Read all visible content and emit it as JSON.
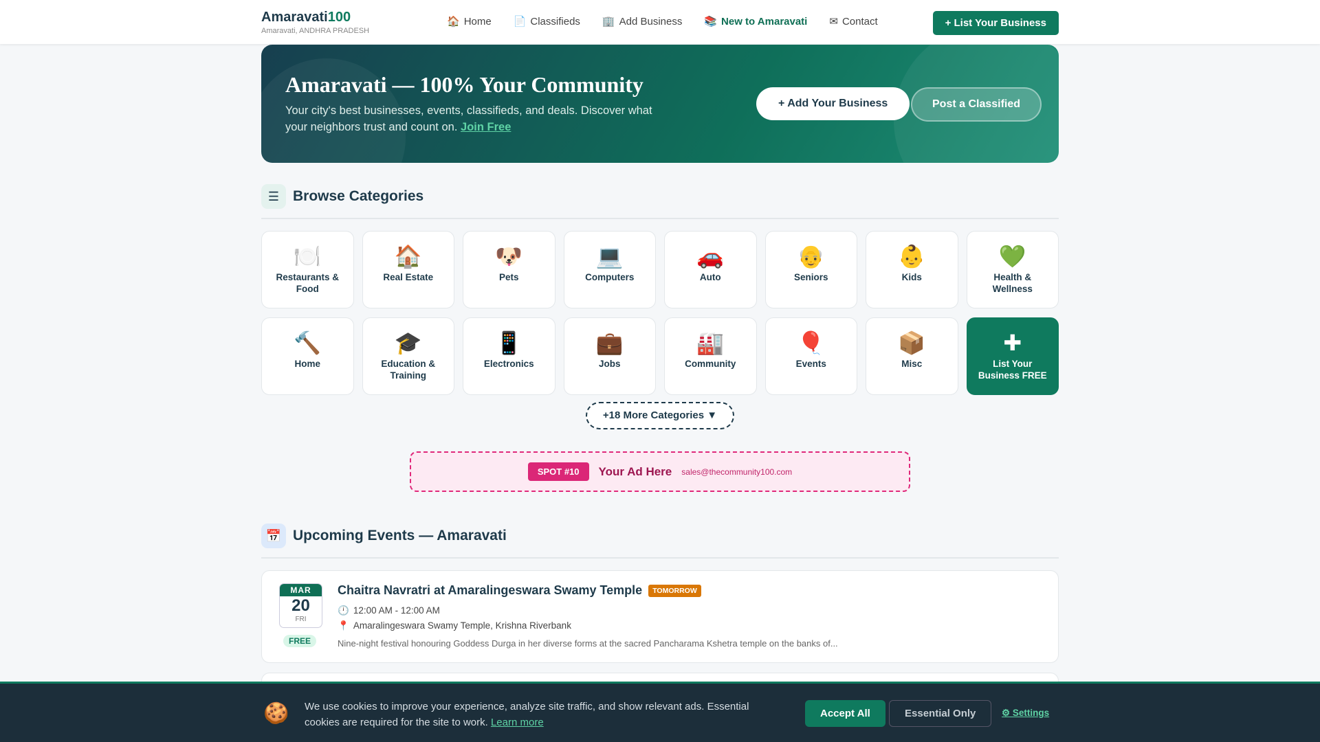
{
  "header": {
    "logo_main": "Amaravati",
    "logo_accent": "100",
    "location": "Amaravati, ANDHRA PRADESH",
    "nav": [
      {
        "icon": "🏠",
        "label": "Home"
      },
      {
        "icon": "📄",
        "label": "Classifieds"
      },
      {
        "icon": "🏢",
        "label": "Add Business"
      },
      {
        "icon": "📚",
        "label": "New to Amaravati"
      },
      {
        "icon": "✉",
        "label": "Contact"
      }
    ],
    "list_button": "+ List Your Business"
  },
  "hero": {
    "title": "Amaravati — 100% Your Community",
    "text": "Your city's best businesses, events, classifieds, and deals. Discover what your neighbors trust and count on.",
    "join": "Join Free",
    "add_button": "+ Add Your Business",
    "post_button": "Post a Classified"
  },
  "categories": {
    "title": "Browse Categories",
    "icon": "☰",
    "items": [
      {
        "icon": "🍽️",
        "label": "Restaurants & Food"
      },
      {
        "icon": "🏠",
        "label": "Real Estate"
      },
      {
        "icon": "🐶",
        "label": "Pets"
      },
      {
        "icon": "💻",
        "label": "Computers"
      },
      {
        "icon": "🚗",
        "label": "Auto"
      },
      {
        "icon": "👴",
        "label": "Seniors"
      },
      {
        "icon": "👶",
        "label": "Kids"
      },
      {
        "icon": "💚",
        "label": "Health & Wellness"
      },
      {
        "icon": "🔨",
        "label": "Home"
      },
      {
        "icon": "🎓",
        "label": "Education & Training"
      },
      {
        "icon": "📱",
        "label": "Electronics"
      },
      {
        "icon": "💼",
        "label": "Jobs"
      },
      {
        "icon": "🏭",
        "label": "Community"
      },
      {
        "icon": "🎈",
        "label": "Events"
      },
      {
        "icon": "📦",
        "label": "Misc"
      }
    ],
    "list_free": {
      "icon": "✚",
      "label": "List Your Business FREE"
    },
    "more": "+18 More Categories ▼"
  },
  "ad": {
    "spot": "SPOT #10",
    "text": "Your Ad Here",
    "email": "sales@thecommunity100.com"
  },
  "events": {
    "title": "Upcoming Events — Amaravati",
    "icon": "📅",
    "items": [
      {
        "month": "MAR",
        "day": "20",
        "weekday": "FRI",
        "price": "FREE",
        "title": "Chaitra Navratri at Amaralingeswara Swamy Temple",
        "badge": "TOMORROW",
        "time": "12:00 AM - 12:00 AM",
        "location": "Amaralingeswara Swamy Temple, Krishna Riverbank",
        "description": "Nine-night festival honouring Goddess Durga in her diverse forms at the sacred Pancharama Kshetra temple on the banks of..."
      }
    ]
  },
  "cookie": {
    "icon": "🍪",
    "text": "We use cookies to improve your experience, analyze site traffic, and show relevant ads. Essential cookies are required for the site to work.",
    "learn": "Learn more",
    "accept": "Accept All",
    "essential": "Essential Only",
    "settings": "⚙ Settings"
  }
}
